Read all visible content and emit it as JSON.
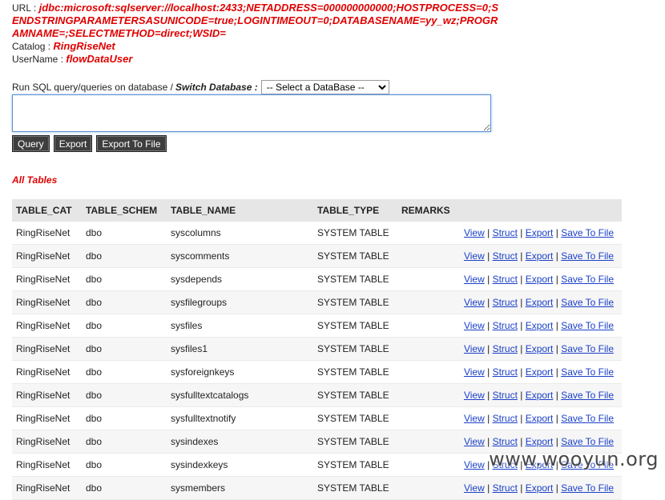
{
  "connection": {
    "url_label": "URL :",
    "url_value": "jdbc:microsoft:sqlserver://localhost:2433;NETADDRESS=000000000000;HOSTPROCESS=0;SENDSTRINGPARAMETERSASUNICODE=true;LOGINTIMEOUT=0;DATABASENAME=yy_wz;PROGRAMNAME=;SELECTMETHOD=direct;WSID=",
    "catalog_label": "Catalog :",
    "catalog_value": "RingRiseNet",
    "username_label": "UserName :",
    "username_value": "flowDataUser"
  },
  "query": {
    "run_label": "Run SQL query/queries on database /",
    "switch_label": "Switch Database :",
    "database_select": "-- Select a DataBase --",
    "sql_text": "",
    "buttons": {
      "query": "Query",
      "export": "Export",
      "export_to_file": "Export To File"
    }
  },
  "tables": {
    "title": "All Tables",
    "columns": [
      "TABLE_CAT",
      "TABLE_SCHEM",
      "TABLE_NAME",
      "TABLE_TYPE",
      "REMARKS"
    ],
    "actions": [
      "View",
      "Struct",
      "Export",
      "Save To File"
    ],
    "rows": [
      {
        "cat": "RingRiseNet",
        "schem": "dbo",
        "name": "syscolumns",
        "type": "SYSTEM TABLE",
        "remarks": ""
      },
      {
        "cat": "RingRiseNet",
        "schem": "dbo",
        "name": "syscomments",
        "type": "SYSTEM TABLE",
        "remarks": ""
      },
      {
        "cat": "RingRiseNet",
        "schem": "dbo",
        "name": "sysdepends",
        "type": "SYSTEM TABLE",
        "remarks": ""
      },
      {
        "cat": "RingRiseNet",
        "schem": "dbo",
        "name": "sysfilegroups",
        "type": "SYSTEM TABLE",
        "remarks": ""
      },
      {
        "cat": "RingRiseNet",
        "schem": "dbo",
        "name": "sysfiles",
        "type": "SYSTEM TABLE",
        "remarks": ""
      },
      {
        "cat": "RingRiseNet",
        "schem": "dbo",
        "name": "sysfiles1",
        "type": "SYSTEM TABLE",
        "remarks": ""
      },
      {
        "cat": "RingRiseNet",
        "schem": "dbo",
        "name": "sysforeignkeys",
        "type": "SYSTEM TABLE",
        "remarks": ""
      },
      {
        "cat": "RingRiseNet",
        "schem": "dbo",
        "name": "sysfulltextcatalogs",
        "type": "SYSTEM TABLE",
        "remarks": ""
      },
      {
        "cat": "RingRiseNet",
        "schem": "dbo",
        "name": "sysfulltextnotify",
        "type": "SYSTEM TABLE",
        "remarks": ""
      },
      {
        "cat": "RingRiseNet",
        "schem": "dbo",
        "name": "sysindexes",
        "type": "SYSTEM TABLE",
        "remarks": ""
      },
      {
        "cat": "RingRiseNet",
        "schem": "dbo",
        "name": "sysindexkeys",
        "type": "SYSTEM TABLE",
        "remarks": ""
      },
      {
        "cat": "RingRiseNet",
        "schem": "dbo",
        "name": "sysmembers",
        "type": "SYSTEM TABLE",
        "remarks": ""
      }
    ]
  },
  "watermark": "www.wooyun.org"
}
